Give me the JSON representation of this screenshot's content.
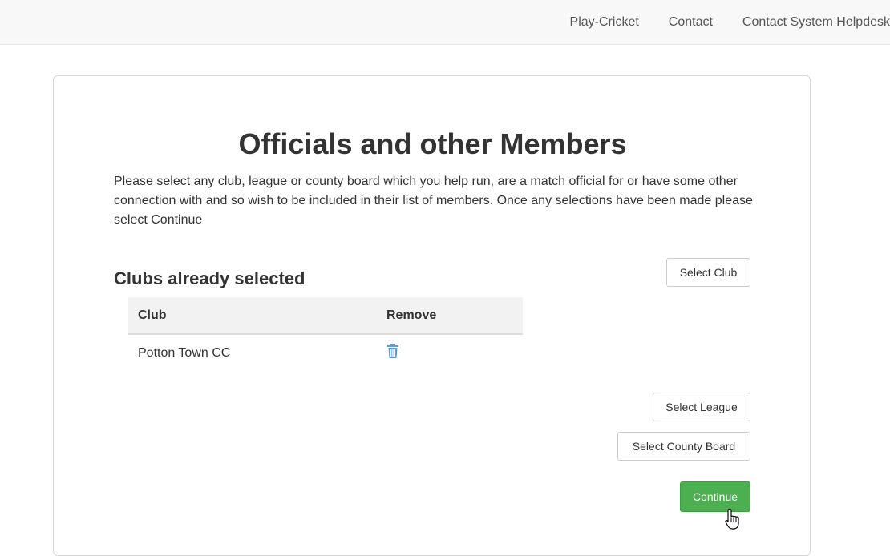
{
  "nav": {
    "items": [
      {
        "label": "Play-Cricket"
      },
      {
        "label": "Contact"
      },
      {
        "label": "Contact System Helpdesk"
      }
    ]
  },
  "page": {
    "title": "Officials and other Members",
    "intro": "Please select any club, league or county board which you help run, are a match official for or have some other connection with and so wish to be included in their list of members. Once any selections have been made please select Continue"
  },
  "clubs_section": {
    "title": "Clubs already selected",
    "select_club_label": "Select Club",
    "table": {
      "headers": [
        "Club",
        "Remove"
      ],
      "rows": [
        {
          "club": "Potton Town CC",
          "remove_icon": "trash-icon"
        }
      ]
    }
  },
  "actions": {
    "select_league_label": "Select League",
    "select_county_board_label": "Select County Board",
    "continue_label": "Continue"
  },
  "colors": {
    "continue_bg": "#4caf50",
    "trash_icon": "#5b9bd5",
    "topbar_bg": "#f8f8f8"
  }
}
